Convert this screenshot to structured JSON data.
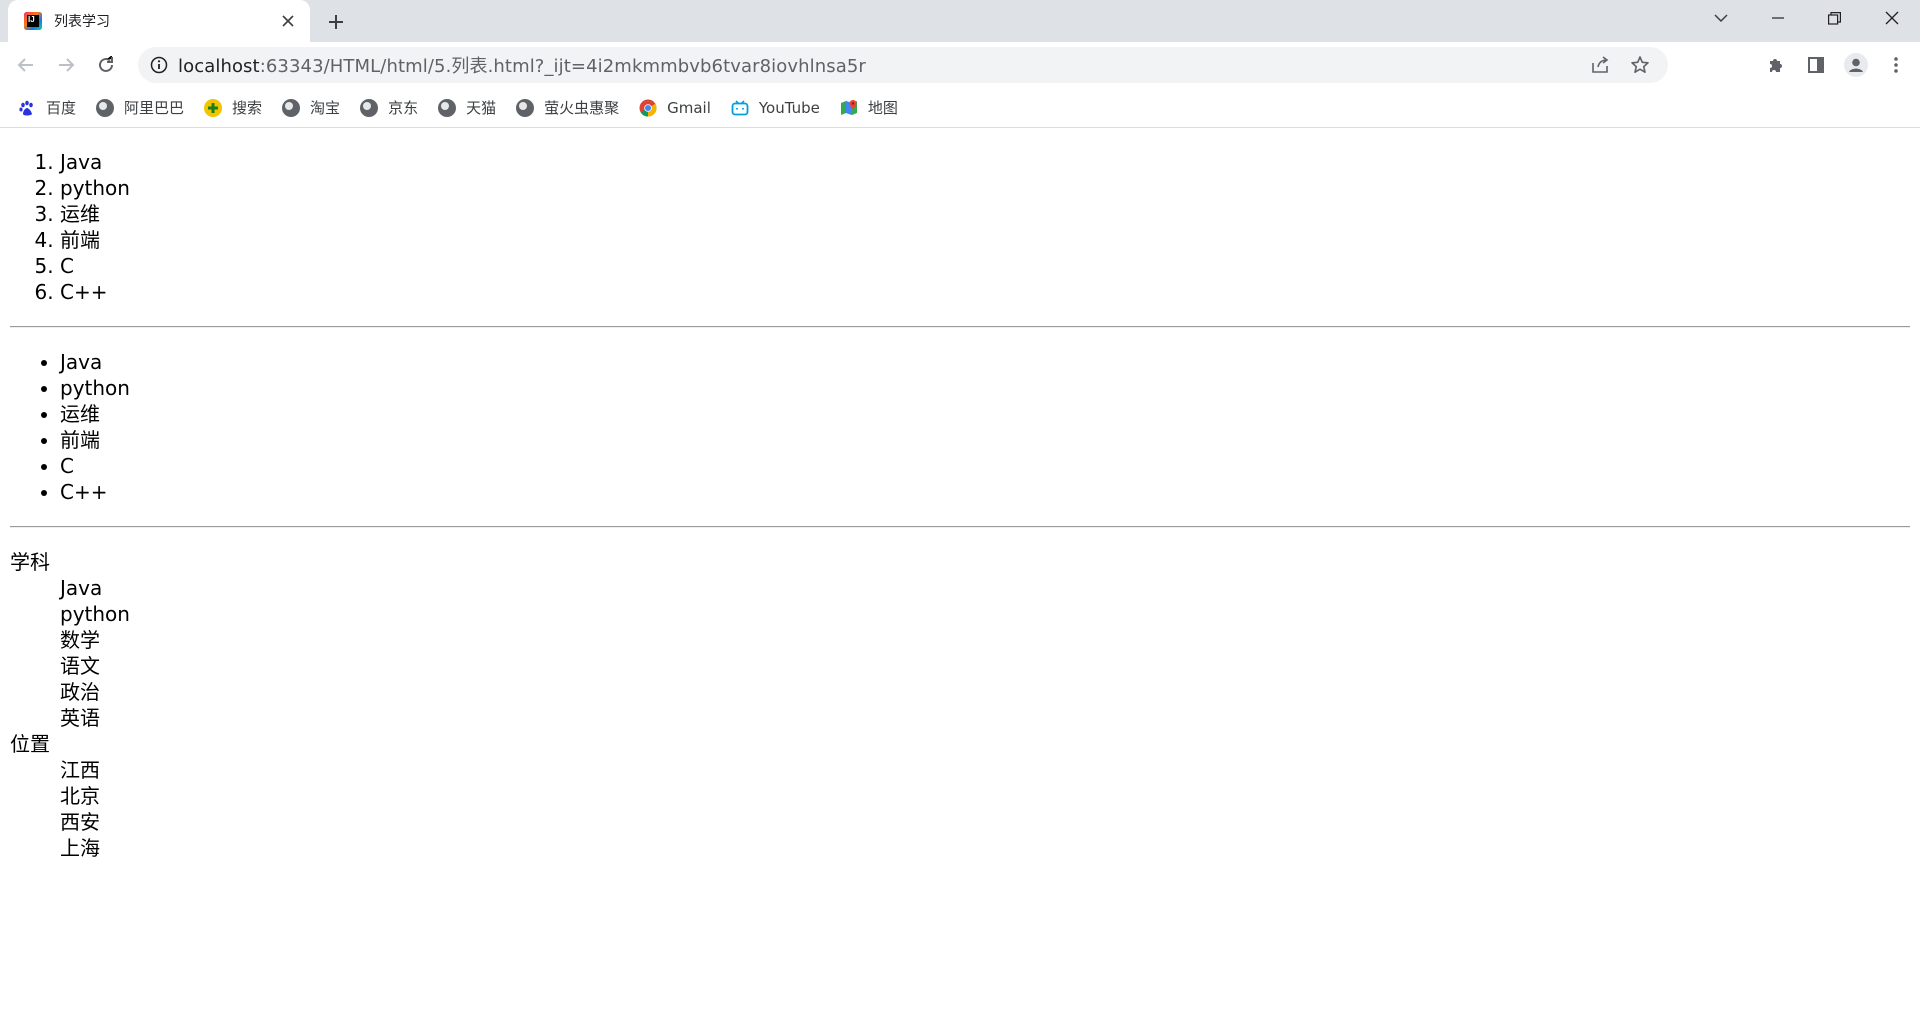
{
  "browser": {
    "tab": {
      "title": "列表学习",
      "favicon_text": "IJ"
    },
    "address": {
      "host": "localhost",
      "path": ":63343/HTML/html/5.列表.html?_ijt=4i2mkmmbvb6tvar8iovhlnsa5r"
    },
    "bookmarks": [
      {
        "label": "百度",
        "icon": "baidu-paw-icon"
      },
      {
        "label": "阿里巴巴",
        "icon": "globe-icon"
      },
      {
        "label": "搜索",
        "icon": "search-plus-icon"
      },
      {
        "label": "淘宝",
        "icon": "globe-icon"
      },
      {
        "label": "京东",
        "icon": "globe-icon"
      },
      {
        "label": "天猫",
        "icon": "globe-icon"
      },
      {
        "label": "萤火虫惠聚",
        "icon": "globe-icon"
      },
      {
        "label": "Gmail",
        "icon": "chrome-icon"
      },
      {
        "label": "YouTube",
        "icon": "bilibili-tv-icon"
      },
      {
        "label": "地图",
        "icon": "maps-icon"
      }
    ]
  },
  "ordered_list": [
    "Java",
    "python",
    "运维",
    "前端",
    "C",
    "C++"
  ],
  "unordered_list": [
    "Java",
    "python",
    "运维",
    "前端",
    "C",
    "C++"
  ],
  "definition_list": [
    {
      "term": "学科",
      "items": [
        "Java",
        "python",
        "数学",
        "语文",
        "政治",
        "英语"
      ]
    },
    {
      "term": "位置",
      "items": [
        "江西",
        "北京",
        "西安",
        "上海"
      ]
    }
  ]
}
